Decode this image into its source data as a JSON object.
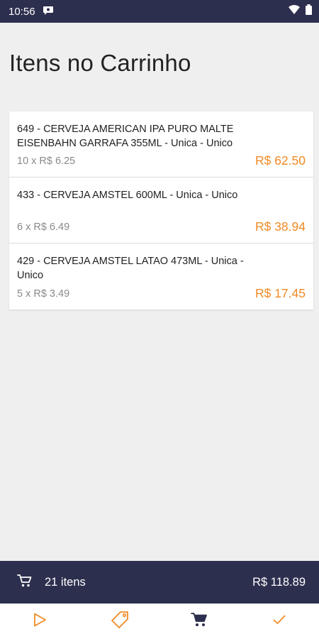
{
  "status_bar": {
    "time": "10:56"
  },
  "page": {
    "title": "Itens no Carrinho"
  },
  "cart": {
    "items": [
      {
        "description": "649 - CERVEJA AMERICAN IPA PURO MALTE EISENBAHN GARRAFA 355ML - Unica - Unico",
        "quantity_price": "10 x R$ 6.25",
        "total": "R$ 62.50"
      },
      {
        "description": "433 - CERVEJA AMSTEL 600ML - Unica - Unico",
        "quantity_price": "6 x R$ 6.49",
        "total": "R$ 38.94"
      },
      {
        "description": "429 - CERVEJA AMSTEL LATAO 473ML - Unica - Unico",
        "quantity_price": "5 x R$ 3.49",
        "total": "R$ 17.45"
      }
    ]
  },
  "summary": {
    "count_label": "21 itens",
    "total": "R$ 118.89"
  },
  "bottom_nav": {
    "items": [
      {
        "icon": "play-icon"
      },
      {
        "icon": "tag-icon"
      },
      {
        "icon": "cart-icon",
        "active": true
      },
      {
        "icon": "check-icon"
      }
    ]
  },
  "colors": {
    "primary_dark": "#2d2f4e",
    "accent_orange": "#f08a24"
  }
}
